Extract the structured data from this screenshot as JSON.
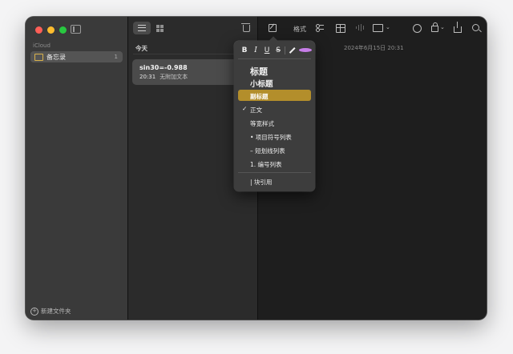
{
  "sidebar": {
    "account": "iCloud",
    "folders": [
      {
        "name": "备忘录",
        "count": "1"
      }
    ],
    "new_folder": "新建文件夹"
  },
  "note_list": {
    "section": "今天",
    "notes": [
      {
        "title": "sin30=-0.988",
        "time": "20:31",
        "preview": "无附加文本"
      }
    ]
  },
  "editor": {
    "format_button": "格式",
    "date": "2024年6月15日 20:31"
  },
  "format_menu": {
    "style_buttons": [
      "B",
      "I",
      "U",
      "S"
    ],
    "items": [
      "标题",
      "小标题",
      "副标题",
      "正文",
      "等宽样式",
      "• 项目符号列表",
      "– 短划线列表",
      "1. 编号列表",
      "| 块引用"
    ],
    "checked_item": "正文",
    "highlighted_item": "副标题",
    "highlight_color": "#b38e2b",
    "text_color_swatch": "#c77ee8"
  },
  "colors": {
    "sidebar_bg": "#3a3a3a",
    "list_bg": "#2b2b2b",
    "editor_bg": "#1e1e1e",
    "folder_icon": "#d9b24b"
  },
  "icons": [
    "sidebar-toggle-icon",
    "list-view-icon",
    "gallery-view-icon",
    "trash-icon",
    "compose-icon",
    "checklist-icon",
    "table-icon",
    "audio-icon",
    "media-icon",
    "collaborate-icon",
    "lock-icon",
    "share-icon",
    "search-icon",
    "folder-icon",
    "plus-circle-icon",
    "highlighter-icon",
    "checkmark-icon"
  ]
}
